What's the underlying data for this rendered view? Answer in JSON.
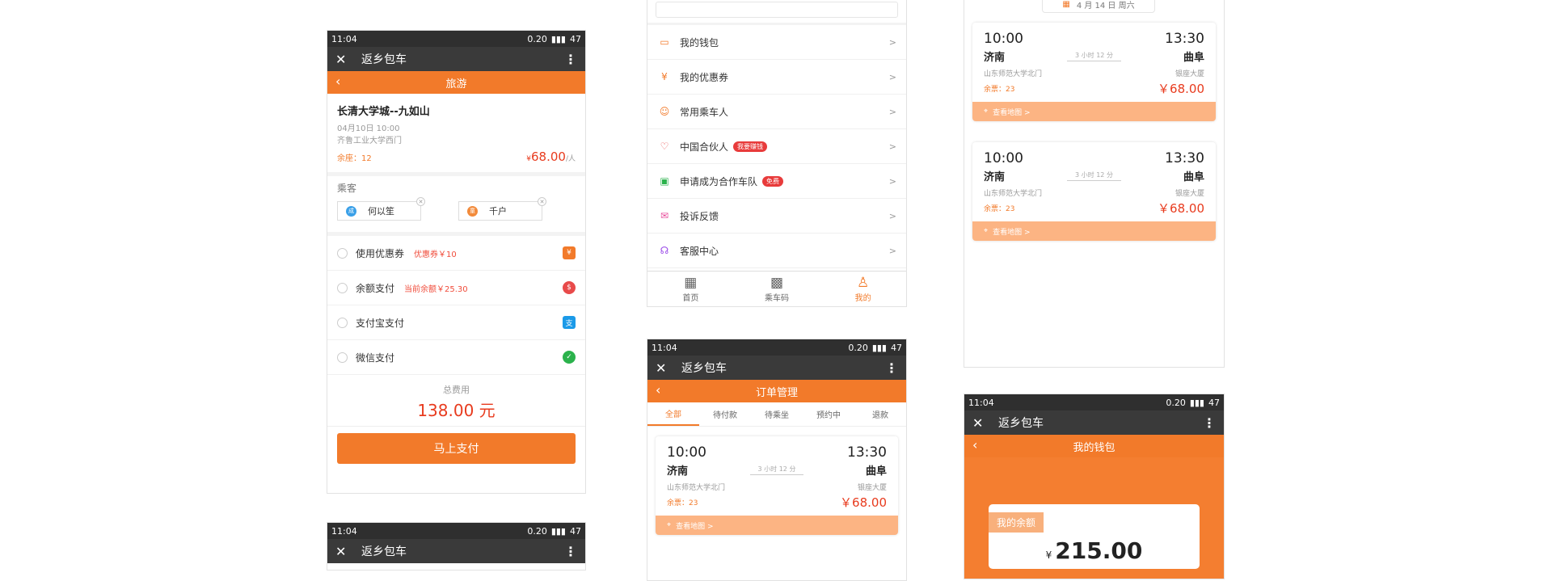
{
  "status": {
    "time": "11:04",
    "speed": "0.20",
    "battery": "47"
  },
  "app": {
    "title": "返乡包车"
  },
  "booking": {
    "header": "旅游",
    "trip_title": "长清大学城--九如山",
    "datetime": "04月10日  10:00",
    "location": "齐鲁工业大学西门",
    "seats": "余座：12",
    "price_symbol": "¥",
    "price": "68.00",
    "per": "/人",
    "passengers_label": "乘客",
    "passengers": [
      {
        "badge": "成",
        "name": "何以笙",
        "color": "#3aa0e8"
      },
      {
        "badge": "童",
        "name": "千户",
        "color": "#f28a3a"
      }
    ],
    "payments": [
      {
        "label": "使用优惠券",
        "hint": "优惠券￥10",
        "icon": "coupon-icon",
        "glyph": "¥",
        "color": "#f27a2a"
      },
      {
        "label": "余额支付",
        "hint": "当前余额￥25.30",
        "icon": "balance-icon",
        "glyph": "$",
        "color": "#e84a4a"
      },
      {
        "label": "支付宝支付",
        "hint": "",
        "icon": "alipay-icon",
        "glyph": "支",
        "color": "#1b9ae8"
      },
      {
        "label": "微信支付",
        "hint": "",
        "icon": "wechat-icon",
        "glyph": "✓",
        "color": "#2bb24c"
      }
    ],
    "total_label": "总费用",
    "total": "138.00 元",
    "pay_button": "马上支付"
  },
  "menu": {
    "items": [
      {
        "label": "我的钱包",
        "icon": "wallet-icon",
        "glyph": "▭",
        "tag": ""
      },
      {
        "label": "我的优惠券",
        "icon": "coupon-icon",
        "glyph": "¥",
        "tag": ""
      },
      {
        "label": "常用乘车人",
        "icon": "contacts-icon",
        "glyph": "☺",
        "tag": ""
      },
      {
        "label": "中国合伙人",
        "icon": "heart-icon",
        "glyph": "♡",
        "tag": "我要赚钱"
      },
      {
        "label": "申请成为合作车队",
        "icon": "bus-icon",
        "glyph": "▣",
        "tag": "免费"
      },
      {
        "label": "投诉反馈",
        "icon": "mail-icon",
        "glyph": "✉",
        "tag": ""
      },
      {
        "label": "客服中心",
        "icon": "headset-icon",
        "glyph": "☊",
        "tag": ""
      }
    ],
    "chevron": ">",
    "tabs": [
      {
        "label": "首页",
        "glyph": "▦",
        "icon": "bus-icon"
      },
      {
        "label": "乘车码",
        "glyph": "▩",
        "icon": "qrcode-icon"
      },
      {
        "label": "我的",
        "glyph": "♙",
        "icon": "person-icon"
      }
    ]
  },
  "orders": {
    "header": "订单管理",
    "tabs": [
      "全部",
      "待付款",
      "待乘坐",
      "预约中",
      "退款"
    ]
  },
  "trip_card": {
    "depart_time": "10:00",
    "arrive_time": "13:30",
    "from": "济南",
    "to": "曲阜",
    "duration": "3 小时 12 分",
    "from_stop": "山东师范大学北门",
    "to_stop": "银座大厦",
    "seats": "余票：23",
    "price": "￥68.00",
    "map_label": "查看地图  >"
  },
  "schedule": {
    "date": "4 月 14 日   周六"
  },
  "wallet": {
    "header": "我的钱包",
    "balance_label": "我的余额",
    "currency": "¥",
    "balance": "215.00"
  }
}
